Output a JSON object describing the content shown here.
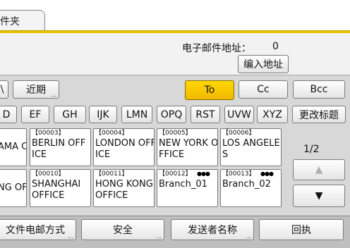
{
  "tab": {
    "label": "邮件夹"
  },
  "header": {
    "count_label": "电子邮件地址：",
    "count_value": "0"
  },
  "toolbar": {
    "enter_address": "编入地址"
  },
  "filters": {
    "partial_left": "\\",
    "recent": "近期"
  },
  "destination": {
    "to": "To",
    "cc": "Cc",
    "bcc": "Bcc",
    "active": "To",
    "active_color": "#f5c400"
  },
  "index_keys": [
    "D",
    "EF",
    "GH",
    "IJK",
    "LMN",
    "OPQ",
    "RST",
    "UVW",
    "XYZ"
  ],
  "edit_title": "更改标题",
  "entries": [
    {
      "id": "",
      "name": "AMA O"
    },
    {
      "id": "【00003】",
      "name": "BERLIN OFF\nICE"
    },
    {
      "id": "【00004】",
      "name": "LONDON OFF\nICE"
    },
    {
      "id": "【00005】",
      "name": "NEW YORK O\nFFICE"
    },
    {
      "id": "【00006】",
      "name": "LOS ANGELE\nS"
    },
    {
      "id": "",
      "name": "NG OF"
    },
    {
      "id": "【00010】",
      "name": "SHANGHAI\nOFFICE"
    },
    {
      "id": "【00011】",
      "name": "HONG KONG\nOFFICE"
    },
    {
      "id": "【00012】",
      "name": "Branch_01"
    },
    {
      "id": "【00013】",
      "name": "Branch_02"
    }
  ],
  "pager": {
    "page": "1/2"
  },
  "bottom": {
    "b1": "文件电邮方式",
    "b2": "安全",
    "b3": "发送者名称",
    "b4": "回执"
  }
}
